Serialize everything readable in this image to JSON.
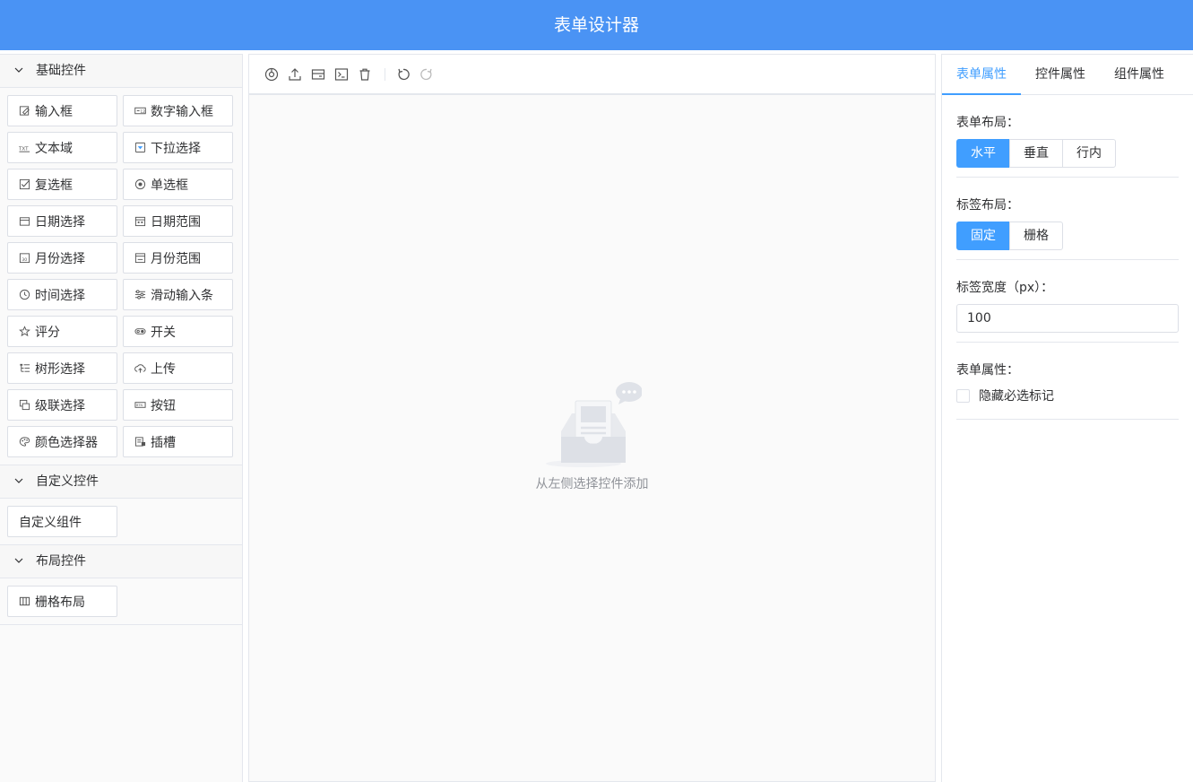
{
  "app_title": "表单设计器",
  "sections": {
    "basic": {
      "title": "基础控件",
      "items": [
        {
          "label": "输入框",
          "icon": "input-icon"
        },
        {
          "label": "数字输入框",
          "icon": "number-input-icon"
        },
        {
          "label": "文本域",
          "icon": "textarea-icon"
        },
        {
          "label": "下拉选择",
          "icon": "select-icon"
        },
        {
          "label": "复选框",
          "icon": "checkbox-icon"
        },
        {
          "label": "单选框",
          "icon": "radio-icon"
        },
        {
          "label": "日期选择",
          "icon": "date-icon"
        },
        {
          "label": "日期范围",
          "icon": "date-range-icon"
        },
        {
          "label": "月份选择",
          "icon": "month-icon"
        },
        {
          "label": "月份范围",
          "icon": "month-range-icon"
        },
        {
          "label": "时间选择",
          "icon": "clock-icon"
        },
        {
          "label": "滑动输入条",
          "icon": "slider-icon"
        },
        {
          "label": "评分",
          "icon": "star-icon"
        },
        {
          "label": "开关",
          "icon": "switch-icon"
        },
        {
          "label": "树形选择",
          "icon": "tree-icon"
        },
        {
          "label": "上传",
          "icon": "upload-cloud-icon"
        },
        {
          "label": "级联选择",
          "icon": "cascader-icon"
        },
        {
          "label": "按钮",
          "icon": "button-icon"
        },
        {
          "label": "颜色选择器",
          "icon": "color-icon"
        },
        {
          "label": "插槽",
          "icon": "slot-icon"
        }
      ]
    },
    "custom": {
      "title": "自定义控件",
      "items": [
        {
          "label": "自定义组件"
        }
      ]
    },
    "layout": {
      "title": "布局控件",
      "items": [
        {
          "label": "栅格布局",
          "icon": "grid-icon"
        }
      ]
    }
  },
  "canvas": {
    "toolbar": [
      "preview-icon",
      "upload-icon",
      "import-icon",
      "code-icon",
      "trash-icon",
      "undo-icon",
      "redo-icon"
    ],
    "empty_text": "从左侧选择控件添加"
  },
  "panel": {
    "tabs": [
      "表单属性",
      "控件属性",
      "组件属性"
    ],
    "form_layout": {
      "label": "表单布局：",
      "options": [
        "水平",
        "垂直",
        "行内"
      ],
      "selected": "水平"
    },
    "label_layout": {
      "label": "标签布局：",
      "options": [
        "固定",
        "栅格"
      ],
      "selected": "固定"
    },
    "label_width": {
      "label": "标签宽度（px）：",
      "value": "100"
    },
    "form_props": {
      "label": "表单属性：",
      "hide_required_label": "隐藏必选标记"
    }
  },
  "colors": {
    "header": "#4a93f4",
    "accent": "#409eff"
  }
}
